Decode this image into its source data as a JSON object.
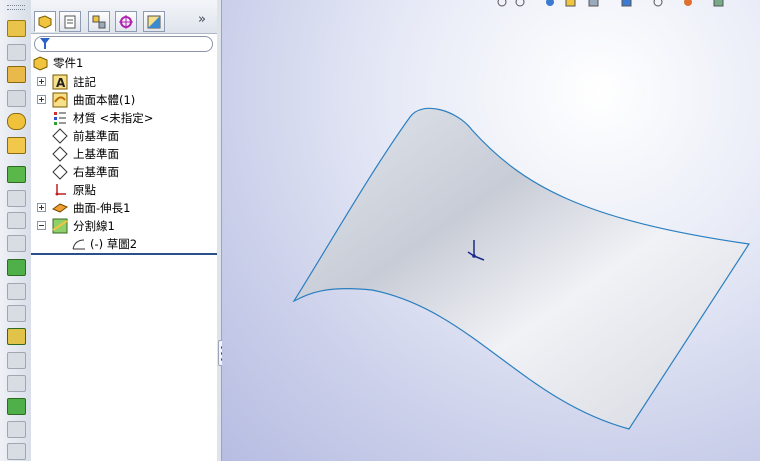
{
  "feature_tree": {
    "root": {
      "label": "零件1",
      "icon": "part-icon"
    },
    "items": [
      {
        "label": "註記",
        "icon": "annotations-icon",
        "expandable": true
      },
      {
        "label": "曲面本體(1)",
        "icon": "surface-bodies-icon",
        "expandable": true
      },
      {
        "label": "材質 <未指定>",
        "icon": "material-icon",
        "expandable": false
      },
      {
        "label": "前基準面",
        "icon": "plane-icon",
        "expandable": false
      },
      {
        "label": "上基準面",
        "icon": "plane-icon",
        "expandable": false
      },
      {
        "label": "右基準面",
        "icon": "plane-icon",
        "expandable": false
      },
      {
        "label": "原點",
        "icon": "origin-icon",
        "expandable": false
      },
      {
        "label": "曲面-伸長1",
        "icon": "surface-extrude-icon",
        "expandable": true
      },
      {
        "label": "分割線1",
        "icon": "split-line-icon",
        "expanded": true
      },
      {
        "label": "(-) 草圖2",
        "icon": "sketch-icon",
        "child": true
      }
    ]
  },
  "tabs": [
    {
      "name": "featuremanager-tab",
      "icon": "featuremanager-icon",
      "active": true
    },
    {
      "name": "propertymanager-tab",
      "icon": "propertymanager-icon"
    },
    {
      "name": "configurationmanager-tab",
      "icon": "configurationmanager-icon"
    },
    {
      "name": "dimxpert-tab",
      "icon": "dimxpert-icon"
    },
    {
      "name": "display-manager-tab",
      "icon": "display-manager-icon"
    }
  ],
  "expand_chevron": "»",
  "colors": {
    "accent": "#2a4f8a",
    "surface_edge": "#2b7fc0",
    "graphics_bg": "#c8cde9"
  }
}
